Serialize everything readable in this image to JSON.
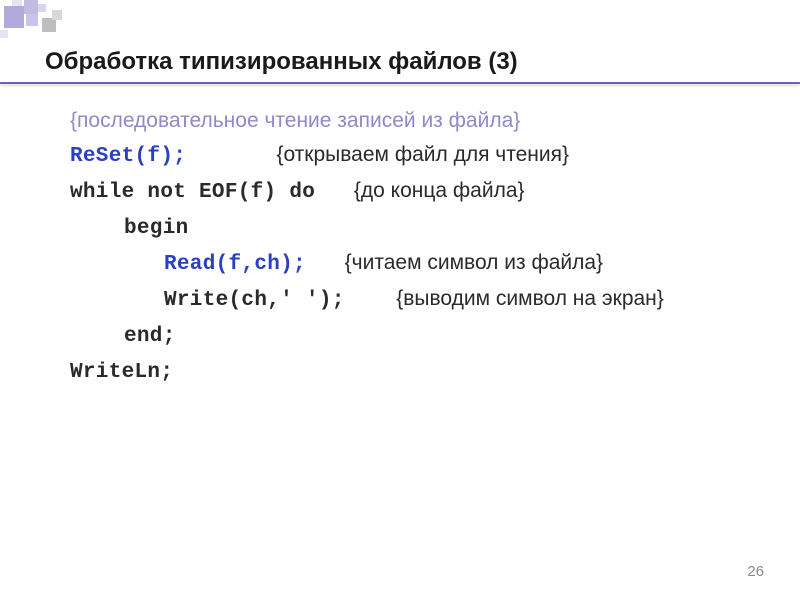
{
  "title": "Обработка типизированных файлов (3)",
  "lines": {
    "l1_comment": "{последовательное чтение записей из файла}",
    "l2_code": "ReSet(f);",
    "l2_comment": "{открываем файл для чтения}",
    "l3_code": "while not EOF(f) do",
    "l3_comment": "{до конца файла}",
    "l4_code": "begin",
    "l5_code": "Read(f,ch);",
    "l5_comment": "{читаем символ из файла}",
    "l6_code": "Write(ch,' ');",
    "l6_comment": "{выводим символ на экран}",
    "l7_code": "end;",
    "l8_code": "WriteLn;"
  },
  "page_number": "26"
}
